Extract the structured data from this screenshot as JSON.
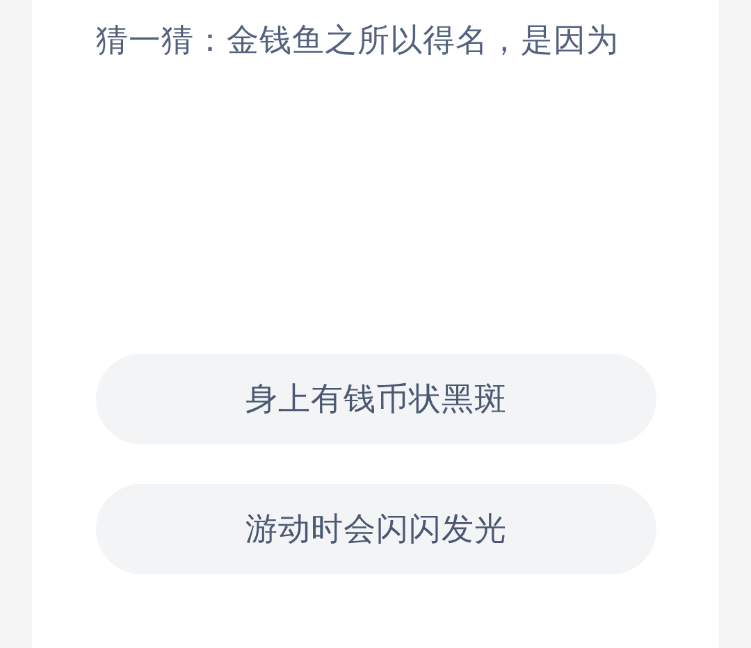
{
  "question": "猜一猜：金钱鱼之所以得名，是因为",
  "options": [
    {
      "label": "身上有钱币状黑斑"
    },
    {
      "label": "游动时会闪闪发光"
    }
  ]
}
